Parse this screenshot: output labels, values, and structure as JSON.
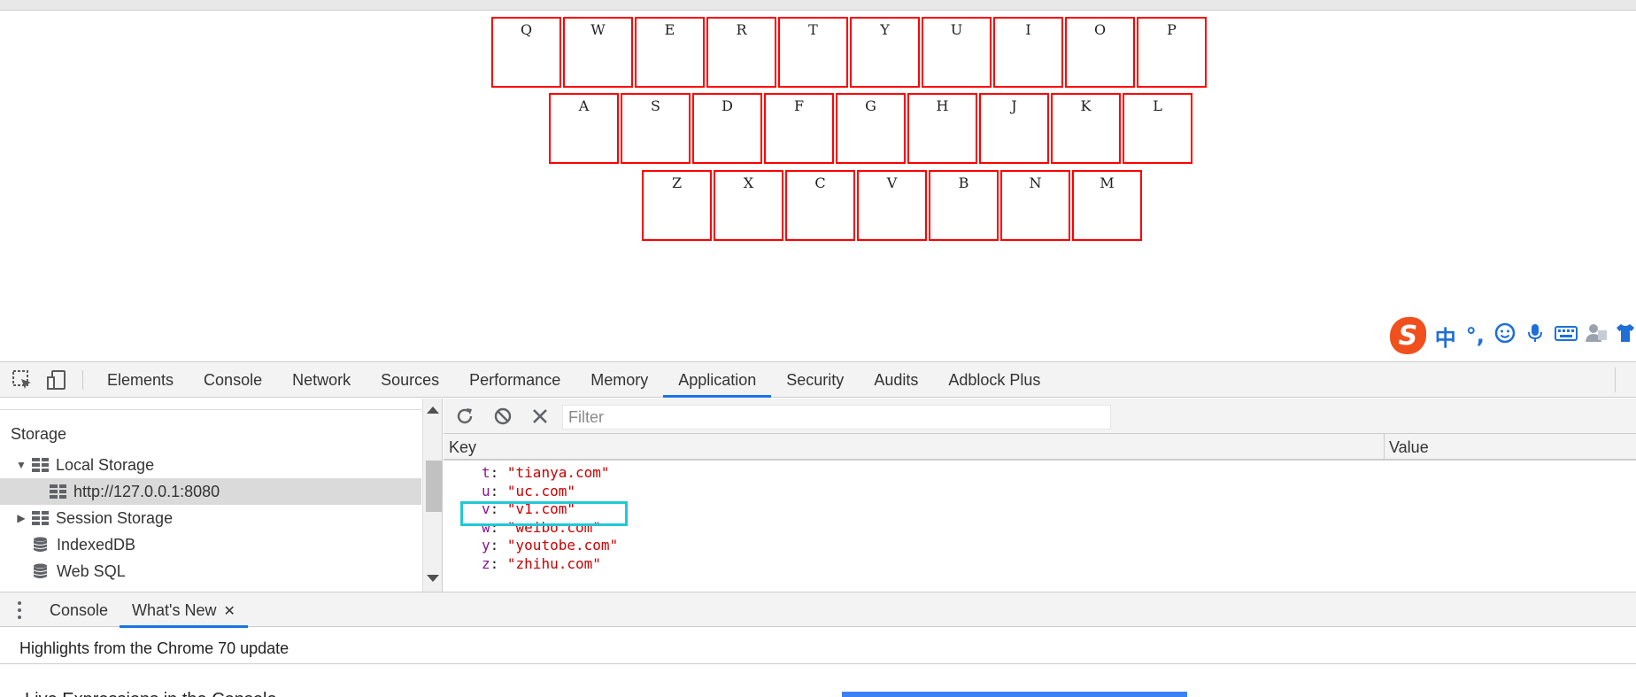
{
  "keyboard": {
    "rows": [
      [
        "Q",
        "W",
        "E",
        "R",
        "T",
        "Y",
        "U",
        "I",
        "O",
        "P"
      ],
      [
        "A",
        "S",
        "D",
        "F",
        "G",
        "H",
        "J",
        "K",
        "L"
      ],
      [
        "Z",
        "X",
        "C",
        "V",
        "B",
        "N",
        "M"
      ]
    ]
  },
  "ime": {
    "logo": "S",
    "mode": "中",
    "punct": "°,",
    "icons": [
      "smile-icon",
      "mic-icon",
      "keyboard-icon",
      "user-icon",
      "shirt-icon"
    ]
  },
  "devtools": {
    "tabs": [
      "Elements",
      "Console",
      "Network",
      "Sources",
      "Performance",
      "Memory",
      "Application",
      "Security",
      "Audits",
      "Adblock Plus"
    ],
    "active_tab": "Application",
    "sidebar": {
      "heading": "Storage",
      "items": [
        {
          "label": "Local Storage",
          "expanded": true,
          "icon": "grid-icon"
        },
        {
          "label": "http://127.0.0.1:8080",
          "selected": true,
          "icon": "grid-icon"
        },
        {
          "label": "Session Storage",
          "expanded": false,
          "icon": "grid-icon"
        },
        {
          "label": "IndexedDB",
          "icon": "database-icon"
        },
        {
          "label": "Web SQL",
          "icon": "database-icon"
        }
      ]
    },
    "filter": {
      "placeholder": "Filter",
      "value": ""
    },
    "columns": {
      "key": "Key",
      "value": "Value"
    },
    "entries": [
      {
        "key": "t",
        "value": "\"tianya.com\""
      },
      {
        "key": "u",
        "value": "\"uc.com\""
      },
      {
        "key": "v",
        "value": "\"v1.com\""
      },
      {
        "key": "w",
        "value": "\"weibo.com\""
      },
      {
        "key": "y",
        "value": "\"youtobe.com\""
      },
      {
        "key": "z",
        "value": "\"zhihu.com\""
      }
    ],
    "highlighted_entry": "v",
    "drawer": {
      "tabs": [
        "Console",
        "What's New"
      ],
      "active_tab": "What's New",
      "close_glyph": "✕",
      "headline": "Highlights from the Chrome 70 update",
      "partial_text": "Live Expressions in the Console"
    }
  },
  "colors": {
    "key_border": "#ff0000",
    "accent": "#1a73e8",
    "highlight_box": "#22c8d8",
    "string": "#c80000",
    "object_key": "#881391"
  }
}
